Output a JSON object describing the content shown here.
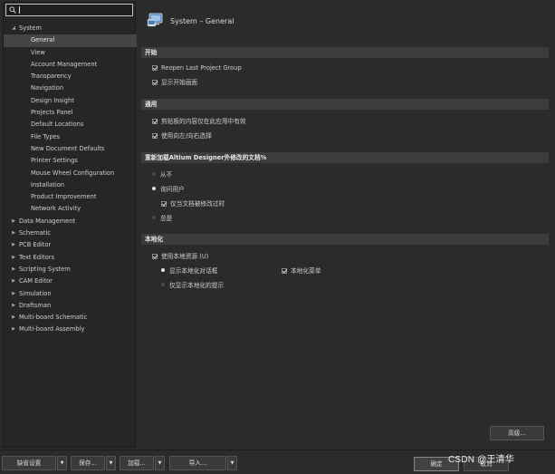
{
  "search": {
    "value": ""
  },
  "tree": [
    {
      "label": "System",
      "level": 0,
      "expanded": true
    },
    {
      "label": "General",
      "level": 1,
      "selected": true
    },
    {
      "label": "View",
      "level": 1
    },
    {
      "label": "Account Management",
      "level": 1
    },
    {
      "label": "Transparency",
      "level": 1
    },
    {
      "label": "Navigation",
      "level": 1
    },
    {
      "label": "Design Insight",
      "level": 1
    },
    {
      "label": "Projects Panel",
      "level": 1
    },
    {
      "label": "Default Locations",
      "level": 1
    },
    {
      "label": "File Types",
      "level": 1
    },
    {
      "label": "New Document Defaults",
      "level": 1
    },
    {
      "label": "Printer Settings",
      "level": 1
    },
    {
      "label": "Mouse Wheel Configuration",
      "level": 1
    },
    {
      "label": "Installation",
      "level": 1
    },
    {
      "label": "Product Improvement",
      "level": 1
    },
    {
      "label": "Network Activity",
      "level": 1
    },
    {
      "label": "Data Management",
      "level": 0,
      "expanded": false
    },
    {
      "label": "Schematic",
      "level": 0,
      "expanded": false
    },
    {
      "label": "PCB Editor",
      "level": 0,
      "expanded": false
    },
    {
      "label": "Text Editors",
      "level": 0,
      "expanded": false
    },
    {
      "label": "Scripting System",
      "level": 0,
      "expanded": false
    },
    {
      "label": "CAM Editor",
      "level": 0,
      "expanded": false
    },
    {
      "label": "Simulation",
      "level": 0,
      "expanded": false
    },
    {
      "label": "Draftsman",
      "level": 0,
      "expanded": false
    },
    {
      "label": "Multi-board Schematic",
      "level": 0,
      "expanded": false
    },
    {
      "label": "Multi-board Assembly",
      "level": 0,
      "expanded": false
    }
  ],
  "header": {
    "title": "System – General"
  },
  "sections": {
    "startup": {
      "title": "开始",
      "reopen_last_project_group": "Reopen Last Project Group",
      "show_start_screen": "显示开始画面"
    },
    "general": {
      "title": "通用",
      "clipboard_this_app_only": "剪贴板的内容仅在此应用中有效",
      "use_left_right_selection": "使用向左/向右选择"
    },
    "reload": {
      "title": "重新加载Altium Designer外修改的文档%",
      "never": "从不",
      "ask_user": "询问用户",
      "only_if_modified": "仅当文档被修改过时",
      "always": "总是"
    },
    "localization": {
      "title": "本地化",
      "use_localized_resources": "使用本地资源 (U)",
      "display_localized_dialogs": "显示本地化对话框",
      "localized_menus": "本地化菜单",
      "display_localized_hints_only": "仅显示本地化的提示"
    }
  },
  "buttons": {
    "advanced": "高级...",
    "set_to_installation_defaults": "缺省设置",
    "save": "保存...",
    "load": "加载...",
    "import": "导入...",
    "ok": "确定",
    "cancel": "取消"
  },
  "watermark": "CSDN @王清华"
}
